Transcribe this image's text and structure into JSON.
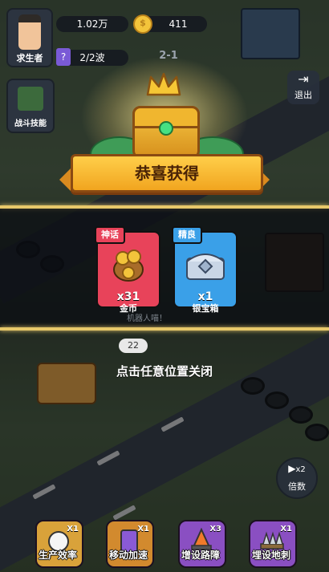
{
  "hud": {
    "player_label": "求生者",
    "power_value": "1.02万",
    "coins_value": "411",
    "wave_value": "2/2波",
    "stage_label": "2-1",
    "skill_label": "战斗技能",
    "exit_label": "退出"
  },
  "reward": {
    "title": "恭喜获得",
    "items": [
      {
        "rarity": "神话",
        "quantity": "x31",
        "name": "金币",
        "color": "#e8435a"
      },
      {
        "rarity": "精良",
        "quantity": "x1",
        "name": "银宝箱",
        "color": "#3aa0e8"
      }
    ],
    "close_hint": "点击任意位置关闭"
  },
  "background": {
    "timer_value": "22",
    "speech_text": "机器人喵！"
  },
  "multiplier": {
    "badge": "x2",
    "label": "倍数"
  },
  "boosts": [
    {
      "label": "生产效率",
      "count": "X1",
      "color": "#d9a23a"
    },
    {
      "label": "移动加速",
      "count": "X1",
      "color": "#d28a2e"
    },
    {
      "label": "增设路障",
      "count": "X3",
      "color": "#8a4fc2"
    },
    {
      "label": "埋设地刺",
      "count": "X1",
      "color": "#8a4fc2"
    }
  ]
}
